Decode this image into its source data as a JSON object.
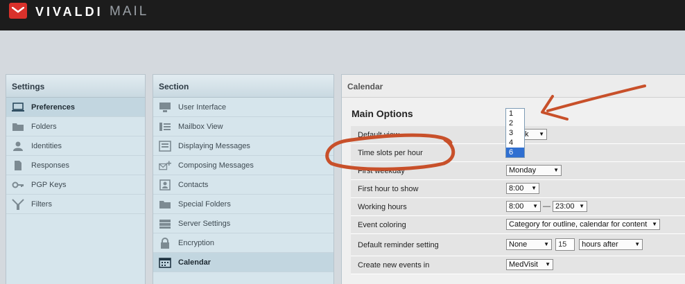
{
  "app": {
    "brand": "VIVALDI",
    "brand_sub": "MAIL"
  },
  "settings_panel": {
    "title": "Settings",
    "items": [
      {
        "label": "Preferences",
        "icon": "monitor-icon",
        "active": true
      },
      {
        "label": "Folders",
        "icon": "folder-icon"
      },
      {
        "label": "Identities",
        "icon": "person-icon"
      },
      {
        "label": "Responses",
        "icon": "document-icon"
      },
      {
        "label": "PGP Keys",
        "icon": "key-icon"
      },
      {
        "label": "Filters",
        "icon": "filter-icon"
      }
    ]
  },
  "section_panel": {
    "title": "Section",
    "items": [
      {
        "label": "User Interface",
        "icon": "monitor-icon"
      },
      {
        "label": "Mailbox View",
        "icon": "list-icon"
      },
      {
        "label": "Displaying Messages",
        "icon": "message-view-icon"
      },
      {
        "label": "Composing Messages",
        "icon": "compose-icon"
      },
      {
        "label": "Contacts",
        "icon": "contacts-icon"
      },
      {
        "label": "Special Folders",
        "icon": "folder-icon"
      },
      {
        "label": "Server Settings",
        "icon": "server-icon"
      },
      {
        "label": "Encryption",
        "icon": "lock-icon"
      },
      {
        "label": "Calendar",
        "icon": "calendar-icon",
        "active": true
      }
    ]
  },
  "calendar_panel": {
    "title": "Calendar",
    "section_title": "Main Options",
    "rows": {
      "default_view": {
        "label": "Default view",
        "value": "k"
      },
      "time_slots": {
        "label": "Time slots per hour"
      },
      "first_weekday": {
        "label": "First weekday",
        "value": "Monday"
      },
      "first_hour": {
        "label": "First hour to show",
        "value": "8:00"
      },
      "working_hours": {
        "label": "Working hours",
        "start": "8:00",
        "separator": "—",
        "end": "23:00"
      },
      "event_coloring": {
        "label": "Event coloring",
        "value": "Category for outline, calendar for content"
      },
      "reminder": {
        "label": "Default reminder setting",
        "type": "None",
        "amount": "15",
        "unit": "hours after"
      },
      "new_events_in": {
        "label": "Create new events in",
        "value": "MedVisit"
      }
    },
    "time_slots_dropdown": {
      "options": [
        "1",
        "2",
        "3",
        "4",
        "6"
      ],
      "selected": "6"
    }
  },
  "colors": {
    "accent_red": "#d9312b",
    "annotation": "#c8502a",
    "selection_blue": "#2f6fd1"
  }
}
